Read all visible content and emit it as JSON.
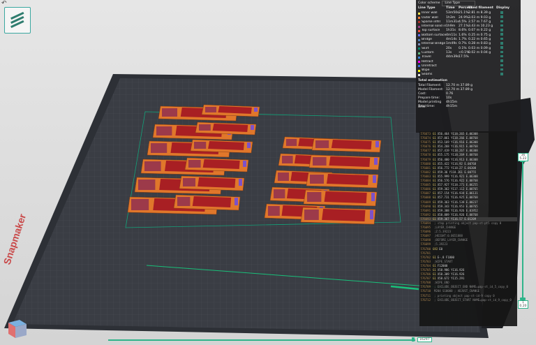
{
  "legend": {
    "title": "Color scheme",
    "scheme": "Line Type",
    "columns": [
      "Line Type",
      "Time",
      "Percent",
      "Used filament",
      "Display"
    ],
    "rows": [
      {
        "name": "Inner wall",
        "time": "53m50s",
        "percent": "21.1%",
        "used": "2.81 m  8.39 g",
        "color": "#ffe64d"
      },
      {
        "name": "Outer wall",
        "time": "1h3m",
        "percent": "24.9%",
        "used": "3.03 m  9.03 g",
        "color": "#ff7d38"
      },
      {
        "name": "Sparse infill",
        "time": "11m31s",
        "percent": "4.5%",
        "used": "2.57 m  7.67 g",
        "color": "#b03029"
      },
      {
        "name": "Internal solid infill",
        "time": "1h9m",
        "percent": "27.1%",
        "used": "3.43 m  10.23 g",
        "color": "#9e3b86"
      },
      {
        "name": "Top surface",
        "time": "1h31s",
        "percent": "8.6%",
        "used": "0.07 m  0.22 g",
        "color": "#f0503c"
      },
      {
        "name": "Bottom surface",
        "time": "4m11s",
        "percent": "1.6%",
        "used": "0.25 m  0.75 g",
        "color": "#6670ff"
      },
      {
        "name": "Bridge",
        "time": "4m14s",
        "percent": "1.7%",
        "used": "0.22 m  0.65 g",
        "color": "#4d80ba"
      },
      {
        "name": "Internal Bridge",
        "time": "1m49s",
        "percent": "0.7%",
        "used": "0.28 m  0.83 g",
        "color": "#7a8fbf"
      },
      {
        "name": "Skirt",
        "time": "20s",
        "percent": "0.1%",
        "used": "0.03 m  0.09 g",
        "color": "#00876e"
      },
      {
        "name": "Custom",
        "time": "13s",
        "percent": "<0.1%",
        "used": "0.02 m  0.04 g",
        "color": "#5eba80"
      },
      {
        "name": "Travel",
        "time": "44m39s",
        "percent": "17.5%",
        "used": "",
        "color": "#3880d9"
      },
      {
        "name": "Retract",
        "time": "",
        "percent": "",
        "used": "",
        "color": "#ff00ff"
      },
      {
        "name": "Unretract",
        "time": "",
        "percent": "",
        "used": "",
        "color": "#3a6ee0"
      },
      {
        "name": "Wipe",
        "time": "",
        "percent": "",
        "used": "",
        "color": "#ffff00"
      },
      {
        "name": "Seams",
        "time": "",
        "percent": "",
        "used": "",
        "color": "#e6e6e6"
      }
    ],
    "estimation_title": "Total estimation",
    "estimation": [
      {
        "label": "Total Filament:",
        "value": "12.70 m    37.89 g"
      },
      {
        "label": "Model Filament:",
        "value": "12.70 m    37.89 g"
      },
      {
        "label": "Cost:",
        "value": "0.76"
      },
      {
        "label": "Prepare time:",
        "value": "10s"
      },
      {
        "label": "Model printing time:",
        "value": "4h15m"
      },
      {
        "label": "Total time:",
        "value": "4h15m"
      }
    ]
  },
  "gcode": [
    {
      "n": "576673",
      "cmd": "G1",
      "text": "X56.464 Y118.265 E.06308"
    },
    {
      "n": "576674",
      "cmd": "G1",
      "text": "X57.061 Y118.266 E.00768"
    },
    {
      "n": "576675",
      "cmd": "G1",
      "text": "X53.169 Y116.916 E.06308"
    },
    {
      "n": "576676",
      "cmd": "G1",
      "text": "X54.268 Y116.915 E.00768"
    },
    {
      "n": "576677",
      "cmd": "G1",
      "text": "X57.419 Y118.267 E.06308"
    },
    {
      "n": "576678",
      "cmd": "G1",
      "text": "X55.175 Y118.269 E.00768"
    },
    {
      "n": "576679",
      "cmd": "G1",
      "text": "X56.400 Y116.913 E.06308"
    },
    {
      "n": "576680",
      "cmd": "G1",
      "text": "X55.422 Y116.92 E.00768"
    },
    {
      "n": "576681",
      "cmd": "G1",
      "text": "X56.772 Y118.27 E.06308"
    },
    {
      "n": "576682",
      "cmd": "G1",
      "text": "X59.36 Y118.261 E.00755"
    },
    {
      "n": "576683",
      "cmd": "G1",
      "text": "X55.999 Y116.921 E.06308"
    },
    {
      "n": "576684",
      "cmd": "G1",
      "text": "X56.576 Y116.922 E.00768"
    },
    {
      "n": "576685",
      "cmd": "G1",
      "text": "X57.927 Y118.271 E.06255"
    },
    {
      "n": "576686",
      "cmd": "G1",
      "text": "X59.362 Y117.112 E.00765"
    },
    {
      "n": "576687",
      "cmd": "G1",
      "text": "X57.154 Y116.934 E.06131"
    },
    {
      "n": "576688",
      "cmd": "G1",
      "text": "X57.731 Y116.925 E.00768"
    },
    {
      "n": "576689",
      "cmd": "G1",
      "text": "X59.363 Y116.538 E.00237"
    },
    {
      "n": "576690",
      "cmd": "G1",
      "text": "X59.343 Y116.953 E.00765"
    },
    {
      "n": "576691",
      "cmd": "G1",
      "text": "X59.308 Y116.926 E.01952"
    },
    {
      "n": "576692",
      "cmd": "G1",
      "text": "X58.889 Y116.926 E.00768"
    },
    {
      "n": "576693",
      "cmd": "G1",
      "text": "X59.367 Y116.57 E.01209",
      "cur": true
    },
    {
      "n": "576694",
      "cmd": "",
      "text": "; stop printing object pap-st-pt5 copy 0",
      "cmt": true
    },
    {
      "n": "576695",
      "cmd": "",
      "text": ";LAYER_CHANGE",
      "cmt": true
    },
    {
      "n": "576696",
      "cmd": "",
      "text": ";Z:5.39223",
      "cmt": true
    },
    {
      "n": "576697",
      "cmd": "",
      "text": ";HEIGHT:0.0651888",
      "cmt": true
    },
    {
      "n": "576698",
      "cmd": "",
      "text": ";BEFORE_LAYER_CHANGE",
      "cmt": true
    },
    {
      "n": "576699",
      "cmd": "",
      "text": ";5.39223",
      "cmt": true
    },
    {
      "n": "576700",
      "cmd": "G92",
      "text": "E0"
    },
    {
      "n": "576701",
      "cmd": "",
      "text": "",
      "cmt": true
    },
    {
      "n": "576702",
      "cmd": "G1",
      "text": "E-.8 F1800"
    },
    {
      "n": "576703",
      "cmd": "",
      "text": ";WIPE_START",
      "cmt": true
    },
    {
      "n": "576704",
      "cmd": "G1",
      "text": "F12000"
    },
    {
      "n": "576705",
      "cmd": "G1",
      "text": "X58.986 Y116.926"
    },
    {
      "n": "576706",
      "cmd": "G1",
      "text": "X58.309 Y116.926"
    },
    {
      "n": "576707",
      "cmd": "G1",
      "text": "X58.672 Y115.291"
    },
    {
      "n": "576708",
      "cmd": "",
      "text": ";WIPE_END",
      "cmt": true
    },
    {
      "n": "576709",
      "cmd": "",
      "text": "; EXCLUDE_OBJECT_END NAME=pap-st_id_5_copy_0",
      "cmt": true
    },
    {
      "n": "576710",
      "cmd": "",
      "text": "M204 S10000 ; ADJUST_CHANGE",
      "cmt": true
    },
    {
      "n": "576711",
      "cmd": "",
      "text": "; printing object pap-st-id-9 copy 0",
      "cmt": true
    },
    {
      "n": "576712",
      "cmd": "",
      "text": "; EXCLUDE_OBJECT_START NAME=pap-st_id_9_copy_0",
      "cmt": true
    }
  ],
  "layer_slider": {
    "top_value": "36",
    "top_height": "5.22",
    "bottom_value": "1",
    "bottom_height": "0.20"
  },
  "move_slider": {
    "value": "16297"
  },
  "bed_brand": "Snapmaker",
  "icons": {
    "back": "back-arrow-icon",
    "cube": "view-cube-icon"
  },
  "colors": {
    "accent": "#2fb48a",
    "object": "#e0772b",
    "infill": "#a81f23"
  }
}
